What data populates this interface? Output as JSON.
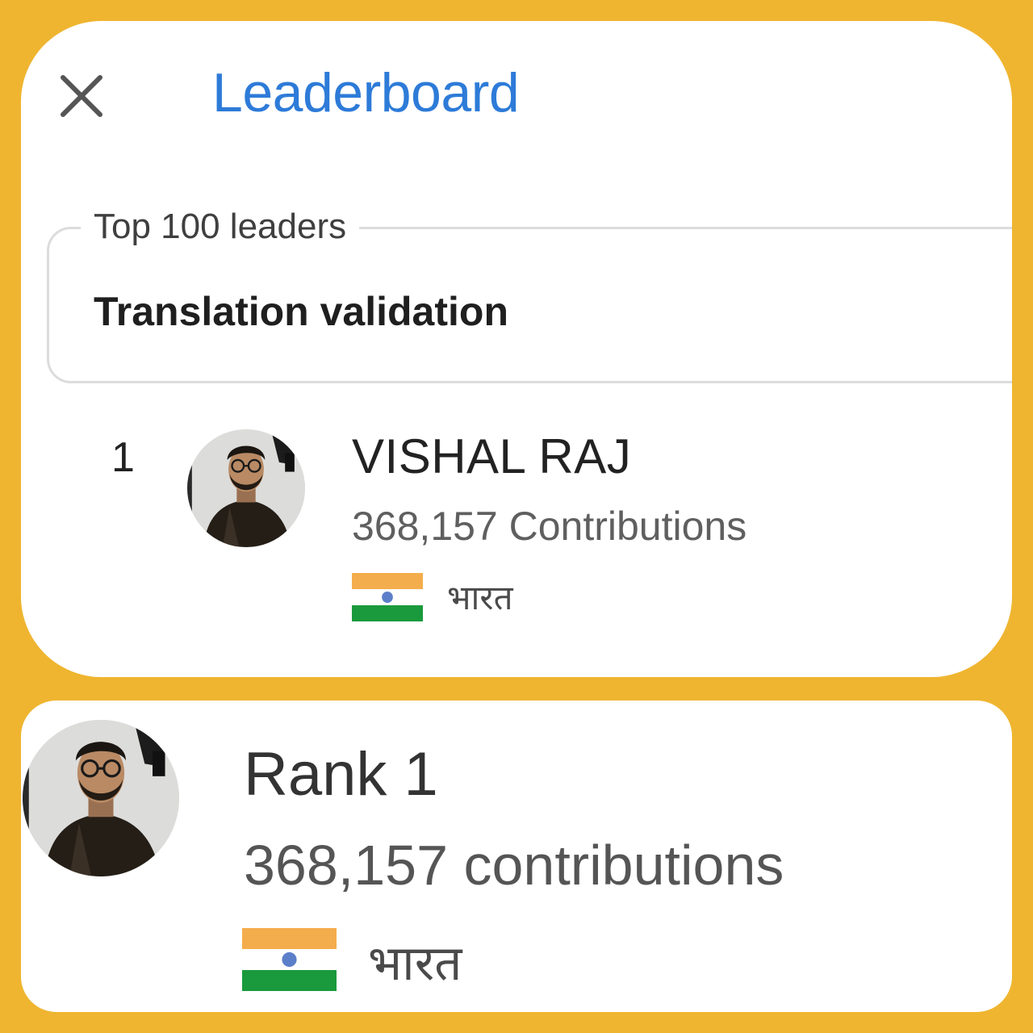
{
  "header": {
    "close_icon": "close-icon",
    "title": "Leaderboard"
  },
  "filter": {
    "legend": "Top 100 leaders",
    "selected": "Translation validation"
  },
  "leaders": [
    {
      "rank": "1",
      "name": "VISHAL RAJ",
      "contributions": "368,157 Contributions",
      "country": "भारत",
      "flag_icon": "india-flag-icon",
      "avatar_icon": "user-avatar"
    }
  ],
  "profile": {
    "rank": "Rank 1",
    "contributions": "368,157 contributions",
    "country": "भारत",
    "flag_icon": "india-flag-icon",
    "avatar_icon": "user-avatar"
  },
  "colors": {
    "background": "#efb530",
    "card": "#ffffff",
    "title": "#2d7bd8",
    "flag_saffron": "#f4ad4c",
    "flag_green": "#1a9a3c",
    "flag_chakra": "#5c7fc9"
  }
}
